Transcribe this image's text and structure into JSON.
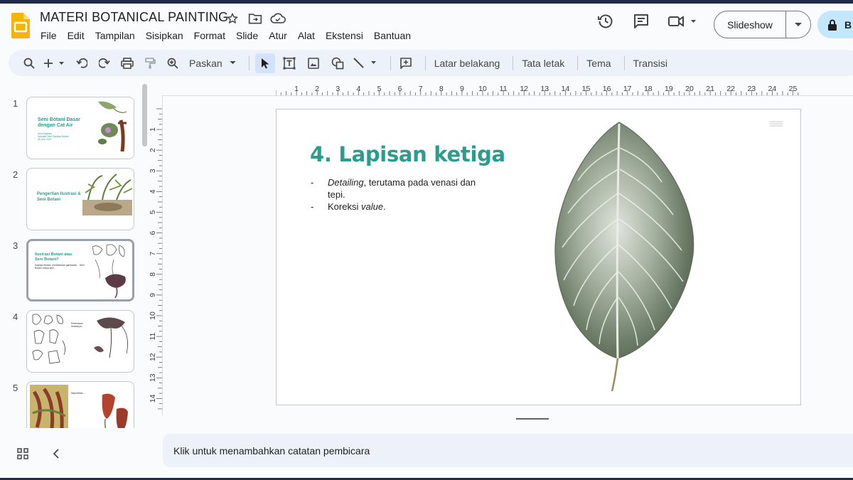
{
  "app": {
    "doc_title": "MATERI BOTANICAL PAINTING",
    "menu": [
      "File",
      "Edit",
      "Tampilan",
      "Sisipkan",
      "Format",
      "Slide",
      "Atur",
      "Alat",
      "Ekstensi",
      "Bantuan"
    ],
    "slideshow_label": "Slideshow",
    "share_label": "B"
  },
  "toolbar": {
    "zoom_label": "Paskan",
    "background_label": "Latar belakang",
    "layout_label": "Tata letak",
    "theme_label": "Tema",
    "transition_label": "Transisi"
  },
  "ruler": {
    "top_marks": [
      "1",
      "2",
      "3",
      "4",
      "5",
      "6",
      "7",
      "8",
      "9",
      "10",
      "11",
      "12",
      "13",
      "14",
      "15",
      "16",
      "17",
      "18",
      "19",
      "20",
      "21",
      "22",
      "23",
      "24",
      "25"
    ],
    "left_marks": [
      "1",
      "2",
      "3",
      "4",
      "5",
      "6",
      "7",
      "8",
      "9",
      "10",
      "11",
      "12",
      "13",
      "14"
    ]
  },
  "filmstrip": [
    {
      "num": "1",
      "title": "Seni Botani Dasar dengan Cat Air",
      "sub": "Ireni Kasbani\nSekolah Seni Gambar Botani\n26 Juni 2023"
    },
    {
      "num": "2",
      "title": "Pengertian Ilustrasi & Seni Botani",
      "sub": ""
    },
    {
      "num": "3",
      "title": "Ilustrasi Botani atau Seni Botani?",
      "sub": "Ilustrasi Botani: memberikan gambaran... Seni Botani: karya seni..."
    },
    {
      "num": "4",
      "title": "",
      "sub": "Perbedaan keduanya..."
    },
    {
      "num": "5",
      "title": "",
      "sub": "Nepenthes ..."
    }
  ],
  "slide": {
    "title": "4. Lapisan ketiga",
    "bullets": [
      {
        "dash": "-",
        "em": "Detailing",
        "rest": ", terutama pada venasi dan tepi."
      },
      {
        "dash": "-",
        "pre": "Koreksi ",
        "em": "value",
        "rest": "."
      }
    ]
  },
  "notes": {
    "placeholder": "Klik untuk menambahkan catatan pembicara"
  },
  "colors": {
    "accent_teal": "#2a9d8f",
    "share_bg": "#c2e7ff",
    "toolbar_bg": "#edf2fa"
  }
}
